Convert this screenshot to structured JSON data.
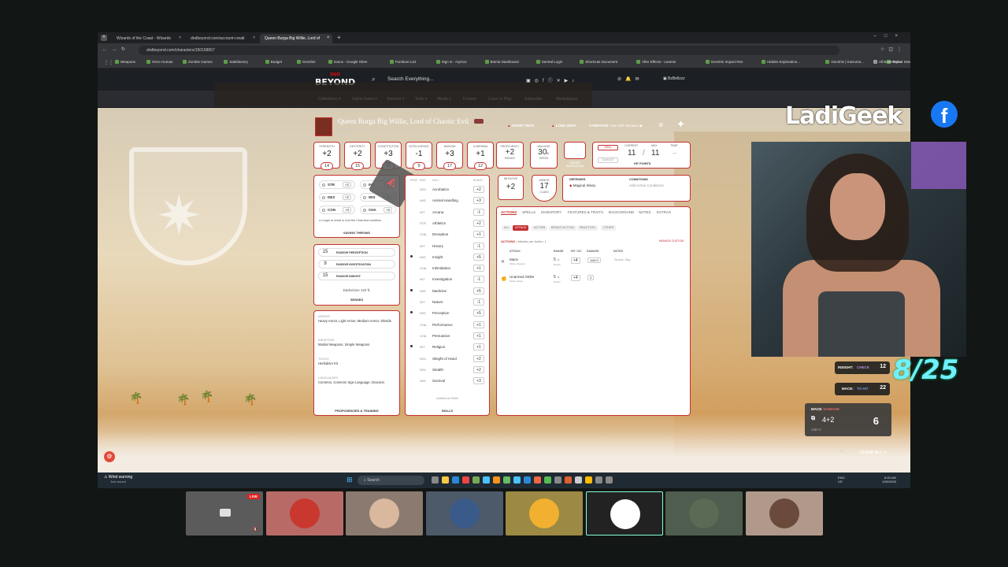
{
  "browser": {
    "tabs": [
      "Wizards of the Coast - Wizards",
      "dndbeyond.com/account-creati",
      "Queen Burga Big Willie, Lord of"
    ],
    "url": "dndbeyond.com/characters/150158657",
    "bookmarks": [
      "Weapons",
      "Once Human",
      "Zombie Games",
      "Satisfactory",
      "Budget",
      "Genshin",
      "Icarus - Google Shee",
      "Furniture List",
      "Sign in - myGov",
      "Botnia Dashboard",
      "Sentral Login",
      "Shortcuts Document",
      "After Effects - Learnin",
      "Genshin Impact Res",
      "Hidden Exploration...",
      "Genshin | Inazuma...",
      "Teyvat Interactive M...",
      "Magic ToDo - Goblin..."
    ],
    "all_bookmarks": "All Bookmarks"
  },
  "site": {
    "logo_top": "D&D",
    "logo": "BEYOND",
    "search_placeholder": "Search Everything...",
    "user": "BzBellzzz",
    "nav": [
      "Collections",
      "Game Rules",
      "Sources",
      "Tools",
      "Media",
      "Forums",
      "Learn to Play",
      "Subscribe",
      "Marketplace"
    ]
  },
  "character": {
    "name": "Queen Burga Big Willie, Lord of Chaotic Evil",
    "subtitle": "Human Fell Cleric 1",
    "level": "Level 1",
    "short_rest": "SHORT REST",
    "long_rest": "LONG REST",
    "campaign_label": "CAMPAIGN:",
    "campaign": "One Shit Wonders",
    "abilities": [
      {
        "label": "STRENGTH",
        "mod": "+2",
        "score": "14"
      },
      {
        "label": "DEXTERITY",
        "mod": "+2",
        "score": "15"
      },
      {
        "label": "CONSTITUTION",
        "mod": "+3",
        "score": "16"
      },
      {
        "label": "INTELLIGENCE",
        "mod": "-1",
        "score": "9"
      },
      {
        "label": "WISDOM",
        "mod": "+3",
        "score": "17"
      },
      {
        "label": "CHARISMA",
        "mod": "+1",
        "score": "12"
      }
    ],
    "proficiency": {
      "label": "PROFICIENCY",
      "value": "+2",
      "sub": "BONUS"
    },
    "walking": {
      "label": "WALKING",
      "value": "30",
      "unit": "ft.",
      "sub": "SPEED"
    },
    "heroic": "HEROIC INSPIRATION",
    "hp": {
      "heal": "HEAL",
      "damage": "DAMAGE",
      "current_label": "CURRENT",
      "max_label": "MAX",
      "temp_label": "TEMP",
      "current": "11",
      "sep": "/",
      "max": "11",
      "temp": "--",
      "title": "HIT POINTS"
    },
    "initiative": {
      "label": "INITIATIVE",
      "value": "+2"
    },
    "armor": {
      "label": "ARMOR",
      "value": "17",
      "sub": "CLASS"
    },
    "defenses": {
      "label": "DEFENSES",
      "value": "Magical Sleep"
    },
    "conditions": {
      "label": "CONDITIONS",
      "value": "Add Active Conditions"
    },
    "saves": [
      {
        "a": "STR",
        "v": "+2"
      },
      {
        "a": "INT",
        "v": "-1"
      },
      {
        "a": "DEX",
        "v": "+2"
      },
      {
        "a": "WIS",
        "v": "+5"
      },
      {
        "a": "CON",
        "v": "+3"
      },
      {
        "a": "CHA",
        "v": "+3"
      }
    ],
    "save_note": "Leaps to resist or end the Charmed condition",
    "saving_throws": "SAVING THROWS",
    "senses": [
      {
        "v": "15",
        "l": "PASSIVE PERCEPTION"
      },
      {
        "v": "9",
        "l": "PASSIVE INVESTIGATION"
      },
      {
        "v": "15",
        "l": "PASSIVE INSIGHT"
      }
    ],
    "darkvision": "Darkvision 120 ft.",
    "senses_label": "SENSES",
    "profs": [
      {
        "h": "ARMOR",
        "t": "Heavy Armor, Light Armor, Medium Armor, Shields"
      },
      {
        "h": "WEAPONS",
        "t": "Martial Weapons, Simple Weapons"
      },
      {
        "h": "TOOLS",
        "t": "Herbalism Kit"
      },
      {
        "h": "LANGUAGES",
        "t": "Common, Common Sign Language, Draconic"
      }
    ],
    "profs_label": "PROFICIENCIES & TRAINING",
    "skills_hdr": [
      "PROF",
      "MOD",
      "SKILL",
      "BONUS"
    ],
    "skills": [
      {
        "p": false,
        "a": "DEX",
        "n": "Acrobatics",
        "b": "+2"
      },
      {
        "p": false,
        "a": "WIS",
        "n": "Animal Handling",
        "b": "+3"
      },
      {
        "p": false,
        "a": "INT",
        "n": "Arcana",
        "b": "-1"
      },
      {
        "p": false,
        "a": "STR",
        "n": "Athletics",
        "b": "+2"
      },
      {
        "p": false,
        "a": "CHA",
        "n": "Deception",
        "b": "+1"
      },
      {
        "p": false,
        "a": "INT",
        "n": "History",
        "b": "-1"
      },
      {
        "p": true,
        "a": "WIS",
        "n": "Insight",
        "b": "+5"
      },
      {
        "p": false,
        "a": "CHA",
        "n": "Intimidation",
        "b": "+1"
      },
      {
        "p": false,
        "a": "INT",
        "n": "Investigation",
        "b": "-1"
      },
      {
        "p": true,
        "a": "WIS",
        "n": "Medicine",
        "b": "+5"
      },
      {
        "p": false,
        "a": "INT",
        "n": "Nature",
        "b": "-1"
      },
      {
        "p": true,
        "a": "WIS",
        "n": "Perception",
        "b": "+5"
      },
      {
        "p": false,
        "a": "CHA",
        "n": "Performance",
        "b": "+1"
      },
      {
        "p": false,
        "a": "CHA",
        "n": "Persuasion",
        "b": "+1"
      },
      {
        "p": true,
        "a": "INT",
        "n": "Religion",
        "b": "+1"
      },
      {
        "p": false,
        "a": "DEX",
        "n": "Sleight of Hand",
        "b": "+2"
      },
      {
        "p": false,
        "a": "DEX",
        "n": "Stealth",
        "b": "+2"
      },
      {
        "p": false,
        "a": "WIS",
        "n": "Survival",
        "b": "+3"
      }
    ],
    "additional_skills": "Additional Skills",
    "skills_label": "SKILLS",
    "action_tabs": [
      "ACTIONS",
      "SPELLS",
      "INVENTORY",
      "FEATURES & TRAITS",
      "BACKGROUND",
      "NOTES",
      "EXTRAS"
    ],
    "filters": [
      "ALL",
      "ATTACK",
      "ACTION",
      "BONUS ACTION",
      "REACTION",
      "OTHER"
    ],
    "actions_header": "ACTIONS",
    "attacks_per": "Attacks per Action: 1",
    "manage": "MANAGE CUSTOM",
    "attack_cols": [
      "ATTACK",
      "RANGE",
      "HIT / DC",
      "DAMAGE",
      "NOTES"
    ],
    "attacks": [
      {
        "name": "Mace",
        "sub": "Melee Weapon",
        "range": "5",
        "unit": "ft.",
        "reach": "Reach",
        "hit": "+4",
        "dmg": "1d6+2",
        "notes": "Simple, Sap"
      },
      {
        "name": "Unarmed Strike",
        "sub": "Melee Attack",
        "range": "5",
        "unit": "ft.",
        "reach": "Reach",
        "hit": "+4",
        "dmg": "3",
        "notes": ""
      }
    ]
  },
  "stream": {
    "brand": "LadiGeek",
    "fb_icon": "f",
    "counter": "8/25",
    "rolls": [
      {
        "name": "INSIGHT:",
        "type": "CHECK",
        "total": "12"
      },
      {
        "name": "MACE:",
        "type": "TO HIT",
        "total": "22"
      }
    ],
    "damage": {
      "name": "MACE:",
      "type": "DAMAGE",
      "expr": "4+2",
      "sub": "1d6+2",
      "total": "6"
    },
    "clear_all": "CLEAR ALL"
  },
  "taskbar": {
    "weather": "Wind warning",
    "weather_sub": "Just issued",
    "search": "Search",
    "lang": "ENG",
    "region": "US",
    "time": "8:00 AM",
    "date": "1/05/2025"
  },
  "call": {
    "live": "LIVE"
  },
  "colors": {
    "accent": "#c53131",
    "cyan": "#6ff0ff"
  }
}
